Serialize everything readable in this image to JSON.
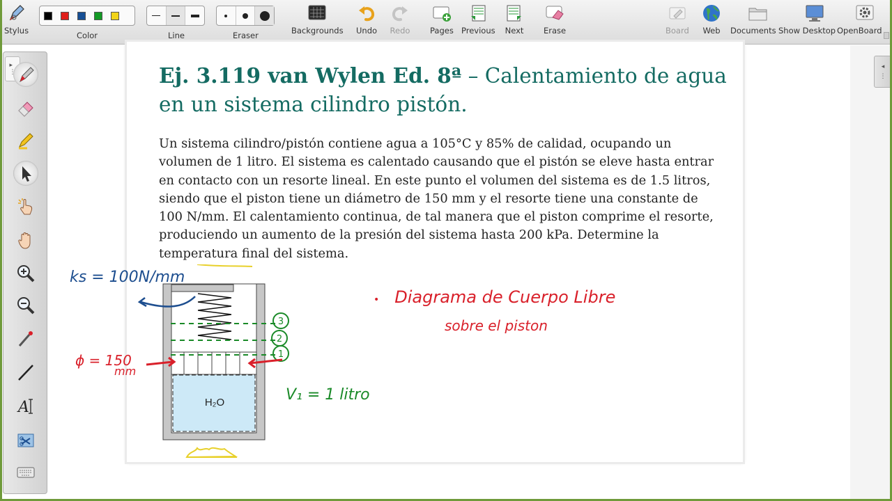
{
  "toolbar": {
    "stylus": "Stylus",
    "color": "Color",
    "line": "Line",
    "eraser": "Eraser",
    "backgrounds": "Backgrounds",
    "undo": "Undo",
    "redo": "Redo",
    "pages": "Pages",
    "previous": "Previous",
    "next": "Next",
    "erase": "Erase",
    "board": "Board",
    "web": "Web",
    "documents": "Documents",
    "show_desktop": "Show Desktop",
    "openboard": "OpenBoard"
  },
  "colors": {
    "swatches": [
      "#000000",
      "#e0201b",
      "#174f95",
      "#139a25",
      "#f2d419"
    ],
    "title": "#146b62",
    "frame": "#6f9a3a",
    "ink_blue": "#1d4e8f",
    "ink_red": "#d9202a",
    "ink_green": "#1a8a28",
    "ink_yellow": "#e8d02a"
  },
  "palette_tools": [
    "pen-icon",
    "eraser-icon",
    "highlighter-icon",
    "selector-icon",
    "interact-icon",
    "hand-icon",
    "zoom-in-icon",
    "zoom-out-icon",
    "laser-pointer-icon",
    "line-icon",
    "text-icon",
    "capture-icon",
    "keyboard-icon"
  ],
  "document": {
    "title_bold": "Ej. 3.119 van Wylen Ed. 8ª",
    "title_rest": " – Calentamiento de agua en un sistema cilindro pistón.",
    "problem": "Un sistema cilindro/pistón contiene agua a 105°C y 85% de calidad, ocupando un volumen de 1 litro. El sistema es calentado causando que el pistón se eleve hasta entrar en contacto con un resorte lineal. En este punto el volumen del sistema es de 1.5 litros, siendo que el piston tiene un diámetro de 150 mm y el resorte tiene una constante de 100 N/mm. El calentamiento continua, de tal manera que el piston comprime el resorte, produciendo un aumento de la presión del sistema hasta 200 kPa. Determine la temperatura final del sistema.",
    "figure_label": "H₂O"
  },
  "annotations": {
    "spring_constant": "ks = 100N/mm",
    "diameter_line1": "ϕ = 150",
    "diameter_line2": "mm",
    "volume": "V₁ = 1 litro",
    "state_1": "1",
    "state_2": "2",
    "state_3": "3",
    "fbd_line1": "Diagrama de Cuerpo Libre",
    "fbd_line2": "sobre el piston"
  }
}
